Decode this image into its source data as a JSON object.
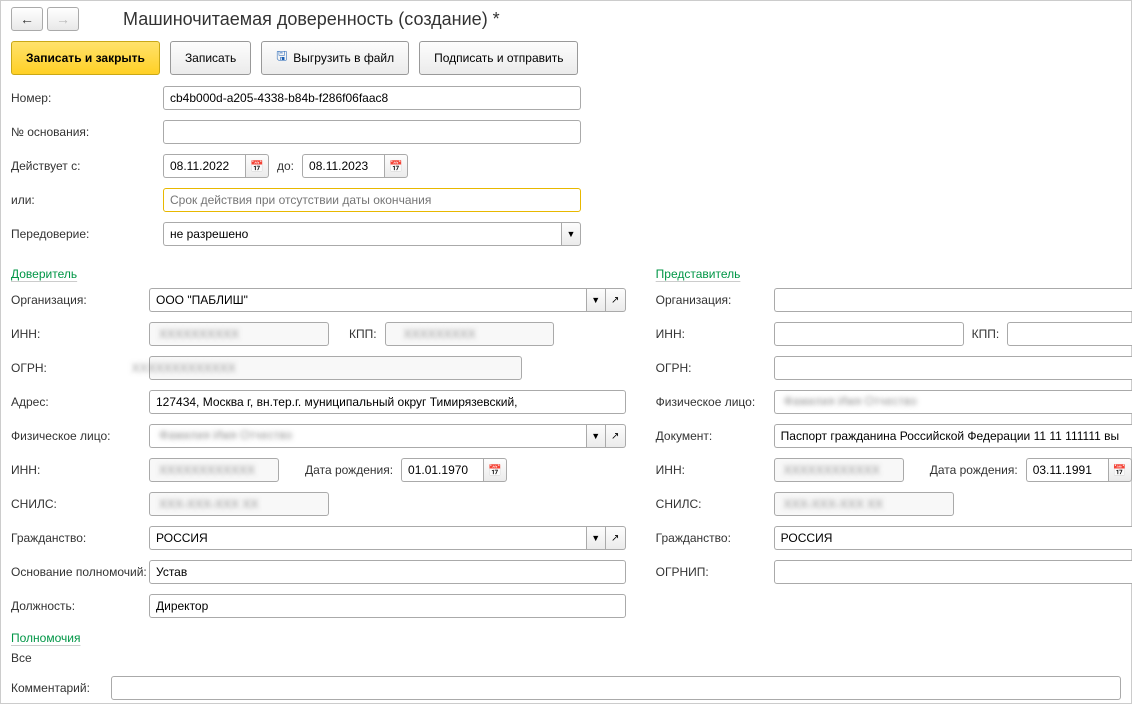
{
  "header": {
    "title": "Машиночитаемая доверенность (создание) *"
  },
  "toolbar": {
    "save_close": "Записать и закрыть",
    "save": "Записать",
    "export": "Выгрузить в файл",
    "sign_send": "Подписать и отправить"
  },
  "main": {
    "number_label": "Номер:",
    "number_value": "cb4b000d-a205-4338-b84b-f286f06faac8",
    "basis_num_label": "№ основания:",
    "basis_num_value": "",
    "valid_from_label": "Действует с:",
    "valid_from": "08.11.2022",
    "to_label": "до:",
    "valid_to": "08.11.2023",
    "or_label": "или:",
    "or_placeholder": "Срок действия при отсутствии даты окончания",
    "redelegation_label": "Передоверие:",
    "redelegation_value": "не разрешено"
  },
  "principal": {
    "title": "Доверитель",
    "org_label": "Организация:",
    "org_value": "ООО \"ПАБЛИШ\"",
    "inn_label": "ИНН:",
    "inn_value": "XXXXXXXXXX",
    "kpp_label": "КПП:",
    "kpp_value": "XXXXXXXXX",
    "ogrn_label": "ОГРН:",
    "ogrn_value": "XXXXXXXXXXXXX",
    "address_label": "Адрес:",
    "address_value": "127434, Москва г, вн.тер.г. муниципальный округ Тимирязевский,",
    "person_label": "Физическое лицо:",
    "person_value": "Фамилия Имя Отчество",
    "inn2_label": "ИНН:",
    "inn2_value": "XXXXXXXXXXXX",
    "dob_label": "Дата рождения:",
    "dob_value": "01.01.1970",
    "snils_label": "СНИЛС:",
    "snils_value": "XXX-XXX-XXX XX",
    "citizenship_label": "Гражданство:",
    "citizenship_value": "РОССИЯ",
    "basis_label": "Основание полномочий:",
    "basis_value": "Устав",
    "position_label": "Должность:",
    "position_value": "Директор"
  },
  "representative": {
    "title": "Представитель",
    "org_label": "Организация:",
    "org_value": "",
    "inn_label": "ИНН:",
    "inn_value": "",
    "kpp_label": "КПП:",
    "kpp_value": "",
    "ogrn_label": "ОГРН:",
    "ogrn_value": "",
    "person_label": "Физическое лицо:",
    "person_value": "Фамилия Имя Отчество",
    "doc_label": "Документ:",
    "doc_value": "Паспорт гражданина Российской Федерации 11 11 111111 вы",
    "inn2_label": "ИНН:",
    "inn2_value": "XXXXXXXXXXXX",
    "dob_label": "Дата рождения:",
    "dob_value": "03.11.1991",
    "snils_label": "СНИЛС:",
    "snils_value": "XXX-XXX-XXX XX",
    "citizenship_label": "Гражданство:",
    "citizenship_value": "РОССИЯ",
    "ogrnip_label": "ОГРНИП:",
    "ogrnip_value": ""
  },
  "authority": {
    "title": "Полномочия",
    "value": "Все",
    "comment_label": "Комментарий:",
    "comment_value": ""
  }
}
